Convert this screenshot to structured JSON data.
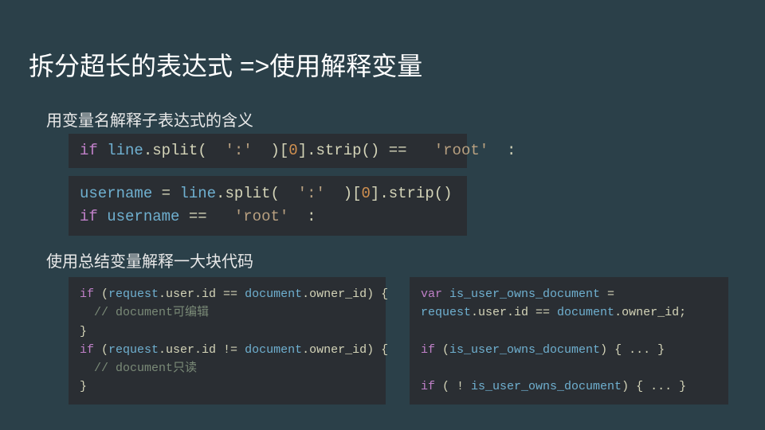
{
  "title": "拆分超长的表达式 =>使用解释变量",
  "subtitle1": "用变量名解释子表达式的含义",
  "subtitle2": "使用总结变量解释一大块代码",
  "box1": {
    "l1": {
      "kw1": "if ",
      "id1": "line",
      "pl1": ".split(",
      "str1": "  ':'  ",
      "pl2": ")[",
      "num1": "0",
      "pl3": "].strip() ==",
      "str2": "   'root'  ",
      "pl4": ":"
    }
  },
  "box2": {
    "l1": {
      "id1": "username",
      "pl1": " = ",
      "id2": "line",
      "pl2": ".split(",
      "str1": "  ':'  ",
      "pl3": ")[",
      "num1": "0",
      "pl4": "].strip()"
    },
    "l2": {
      "kw1": "if ",
      "id1": "username",
      "pl1": " ==",
      "str1": "   'root'  ",
      "pl2": ":"
    }
  },
  "box3": {
    "l1": {
      "kw1": "if ",
      "pl1": "(",
      "id1": "request",
      "pl2": ".user.id == ",
      "id2": "document",
      "pl3": ".owner_id) {"
    },
    "l2": {
      "cm1": "  // document可编辑"
    },
    "l3": {
      "pl1": "}"
    },
    "l4": {
      "kw1": "if ",
      "pl1": "(",
      "id1": "request",
      "pl2": ".user.id != ",
      "id2": "document",
      "pl3": ".owner_id) {"
    },
    "l5": {
      "cm1": "  // document只读"
    },
    "l6": {
      "pl1": "}"
    }
  },
  "box4": {
    "l1": {
      "kw1": "var ",
      "id1": "is_user_owns_document",
      "pl1": " ="
    },
    "l2": {
      "id1": "request",
      "pl1": ".user.id == ",
      "id2": "document",
      "pl2": ".owner_id;"
    },
    "l3": {
      "pl1": " "
    },
    "l4": {
      "kw1": "if ",
      "pl1": "(",
      "id1": "is_user_owns_document",
      "pl2": ") { ... }"
    },
    "l5": {
      "pl1": " "
    },
    "l6": {
      "kw1": "if ",
      "pl1": "( ! ",
      "id1": "is_user_owns_document",
      "pl2": ") { ... }"
    }
  }
}
